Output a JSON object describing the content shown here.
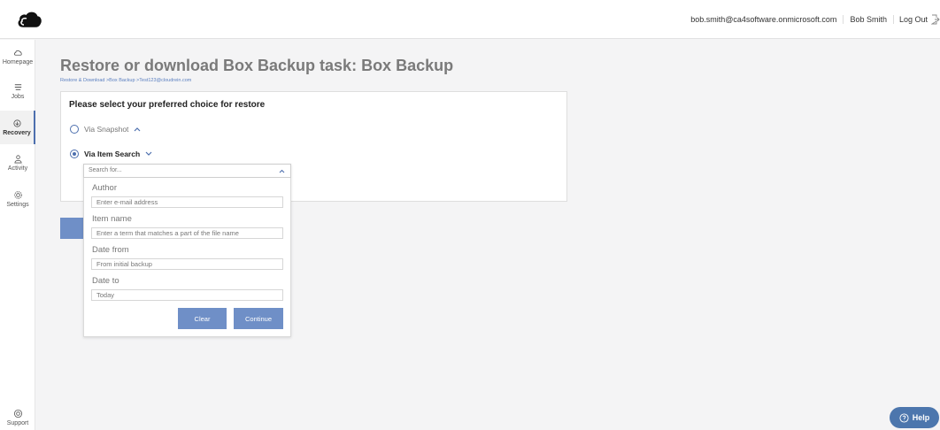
{
  "header": {
    "email": "bob.smith@ca4software.onmicrosoft.com",
    "user_name": "Bob Smith",
    "logout_label": "Log Out"
  },
  "sidebar": {
    "items": [
      {
        "label": "Homepage",
        "icon": "cloud-icon"
      },
      {
        "label": "Jobs",
        "icon": "jobs-icon"
      },
      {
        "label": "Recovery",
        "icon": "recovery-icon",
        "active": true
      },
      {
        "label": "Activity",
        "icon": "person-icon"
      },
      {
        "label": "Settings",
        "icon": "gear-icon"
      }
    ],
    "support_label": "Support"
  },
  "page": {
    "title": "Restore or download Box Backup task: Box Backup",
    "breadcrumb": "Restore & Download >Box Backup >Test123@cloudrein.com"
  },
  "restore_card": {
    "title": "Please select your preferred choice for restore",
    "option_snapshot": "Via Snapshot",
    "option_item_search": "Via Item Search"
  },
  "search_panel": {
    "placeholder": "Search for...",
    "author_label": "Author",
    "author_placeholder": "Enter e-mail address",
    "item_name_label": "Item name",
    "item_name_placeholder": "Enter a term that matches a part of the file name",
    "date_from_label": "Date from",
    "date_from_placeholder": "From initial backup",
    "date_to_label": "Date to",
    "date_to_placeholder": "Today",
    "clear_label": "Clear",
    "continue_label": "Continue"
  },
  "help_label": "Help",
  "colors": {
    "accent": "#4d6fae",
    "button": "#6f8fc7",
    "help": "#4c76ad"
  }
}
